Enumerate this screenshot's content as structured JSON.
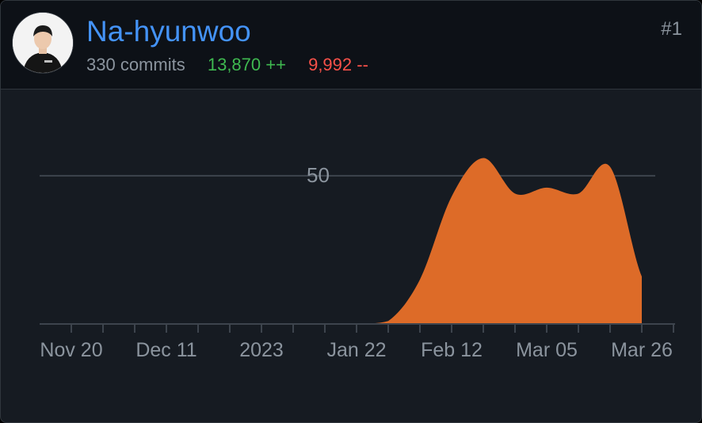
{
  "contributor": {
    "name": "Na-hyunwoo",
    "commits": "330 commits",
    "additions": "13,870 ++",
    "deletions": "9,992 --",
    "rank": "#1"
  },
  "colors": {
    "background": "#161b22",
    "header_background": "#0d1117",
    "name": "#4493f8",
    "additions": "#3fb950",
    "deletions": "#f85149",
    "area_fill": "#dd6b28",
    "muted_text": "#8b949e",
    "gridline": "#3d444d"
  },
  "chart_data": {
    "type": "area",
    "x": [
      "2022-11-06",
      "2022-11-13",
      "2022-11-20",
      "2022-11-27",
      "2022-12-04",
      "2022-12-11",
      "2022-12-18",
      "2022-12-25",
      "2023-01-01",
      "2023-01-08",
      "2023-01-15",
      "2023-01-22",
      "2023-01-29",
      "2023-02-05",
      "2023-02-12",
      "2023-02-19",
      "2023-02-26",
      "2023-03-05",
      "2023-03-12",
      "2023-03-19",
      "2023-03-26"
    ],
    "series": [
      {
        "values": [
          0,
          0,
          0,
          0,
          0,
          0,
          0,
          0,
          0,
          0,
          0,
          1,
          15,
          43,
          56,
          44,
          46,
          44,
          53,
          16,
          0
        ]
      }
    ],
    "y_gridlines": [
      50
    ],
    "y_tick_labels": [
      "50"
    ],
    "ylim": [
      0,
      62
    ],
    "x_tick_labels": [
      "Nov 20",
      "Dec 11",
      "2023",
      "Jan 22",
      "Feb 12",
      "Mar 05",
      "Mar 26"
    ],
    "grid": true,
    "legend": "none"
  }
}
